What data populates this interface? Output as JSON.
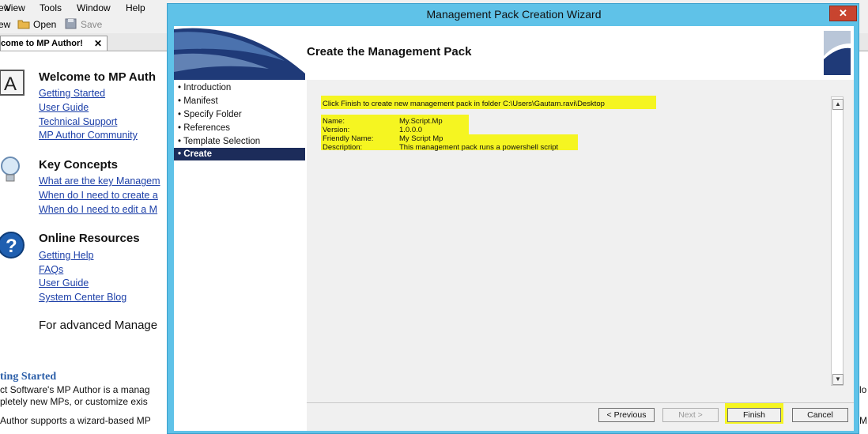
{
  "background_app": {
    "menu": [
      "ew",
      "View",
      "Tools",
      "Window",
      "Help"
    ],
    "toolbar": {
      "open_label": "Open",
      "save_label": "Save"
    },
    "tab_label": "come to MP Author!",
    "tab_close": "✕",
    "welcome": {
      "title": "Welcome to MP Auth",
      "links": [
        "Getting Started",
        "User Guide",
        "Technical Support",
        "MP Author Community"
      ]
    },
    "key_concepts": {
      "title": "Key Concepts",
      "links": [
        "What are the key Managem",
        "When do I need to create a",
        "When do I need to edit a M"
      ]
    },
    "online_resources": {
      "title": "Online Resources",
      "links": [
        "Getting Help",
        "FAQs",
        "User Guide",
        "System Center Blog"
      ]
    },
    "advanced_text": "For advanced Manage",
    "getting_started": {
      "title": "ting Started",
      "lines": [
        "ct Software's MP Author is a manag",
        "pletely new MPs, or customize exis",
        "Author supports a wizard-based MP"
      ]
    },
    "right_edge_fragments": [
      "lo",
      "M"
    ]
  },
  "wizard": {
    "window_title": "Management Pack Creation Wizard",
    "close_glyph": "✕",
    "page_title": "Create the Management Pack",
    "nav_items": [
      {
        "label": "• Introduction",
        "active": false
      },
      {
        "label": "• Manifest",
        "active": false
      },
      {
        "label": "• Specify Folder",
        "active": false
      },
      {
        "label": "• References",
        "active": false
      },
      {
        "label": "• Template Selection",
        "active": false
      },
      {
        "label": "• Create",
        "active": true
      }
    ],
    "summary": {
      "intro": "Click Finish to create new management pack in folder C:\\Users\\Gautam.ravi\\Desktop",
      "fields": [
        {
          "label": "Name:",
          "value": "My.Script.Mp"
        },
        {
          "label": "Version:",
          "value": "1.0.0.0"
        },
        {
          "label": "Friendly Name:",
          "value": "My Script Mp"
        },
        {
          "label": "Description:",
          "value": "This management pack runs a powershell script"
        }
      ]
    },
    "scroll_up_glyph": "▲",
    "scroll_down_glyph": "▼",
    "buttons": {
      "previous": "< Previous",
      "next": "Next >",
      "finish": "Finish",
      "cancel": "Cancel"
    },
    "highlight_color": "#f5f521",
    "frame_color": "#5fc2e8",
    "nav_active_color": "#1c2c5a"
  }
}
